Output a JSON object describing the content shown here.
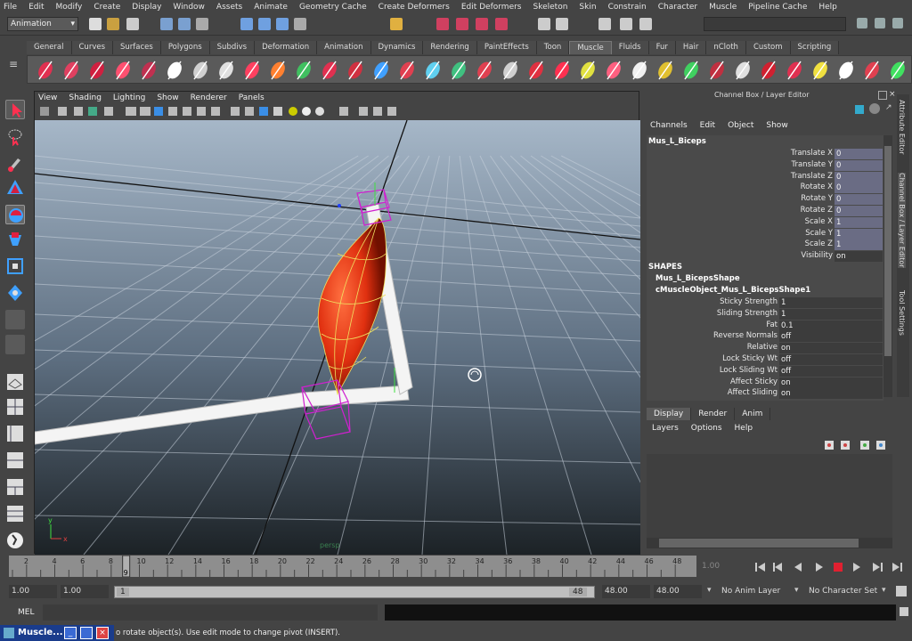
{
  "menu": [
    "File",
    "Edit",
    "Modify",
    "Create",
    "Display",
    "Window",
    "Assets",
    "Animate",
    "Geometry Cache",
    "Create Deformers",
    "Edit Deformers",
    "Skeleton",
    "Skin",
    "Constrain",
    "Character",
    "Muscle",
    "Pipeline Cache",
    "Help"
  ],
  "status": {
    "mode": "Animation"
  },
  "shelf_tabs": [
    "General",
    "Curves",
    "Surfaces",
    "Polygons",
    "Subdivs",
    "Deformation",
    "Animation",
    "Dynamics",
    "Rendering",
    "PaintEffects",
    "Toon",
    "Muscle",
    "Fluids",
    "Fur",
    "Hair",
    "nCloth",
    "Custom",
    "Scripting"
  ],
  "active_shelf": "Muscle",
  "viewport": {
    "menu": [
      "View",
      "Shading",
      "Lighting",
      "Show",
      "Renderer",
      "Panels"
    ],
    "persp_label": "persp",
    "axis_y": "y",
    "axis_x": "x"
  },
  "channel_box": {
    "title": "Channel Box / Layer Editor",
    "menu": [
      "Channels",
      "Edit",
      "Object",
      "Show"
    ],
    "object": "Mus_L_Biceps",
    "attributes": [
      {
        "label": "Translate X",
        "value": "0"
      },
      {
        "label": "Translate Y",
        "value": "0"
      },
      {
        "label": "Translate Z",
        "value": "0"
      },
      {
        "label": "Rotate X",
        "value": "0"
      },
      {
        "label": "Rotate Y",
        "value": "0"
      },
      {
        "label": "Rotate Z",
        "value": "0"
      },
      {
        "label": "Scale X",
        "value": "1"
      },
      {
        "label": "Scale Y",
        "value": "1"
      },
      {
        "label": "Scale Z",
        "value": "1"
      },
      {
        "label": "Visibility",
        "value": "on"
      }
    ],
    "shapes_header": "SHAPES",
    "shape1": "Mus_L_BicepsShape",
    "shape2": "cMuscleObject_Mus_L_BicepsShape1",
    "shape_attrs": [
      {
        "label": "Sticky Strength",
        "value": "1"
      },
      {
        "label": "Sliding Strength",
        "value": "1"
      },
      {
        "label": "Fat",
        "value": "0.1"
      },
      {
        "label": "Reverse Normals",
        "value": "off"
      },
      {
        "label": "Relative",
        "value": "on"
      },
      {
        "label": "Lock Sticky Wt",
        "value": "off"
      },
      {
        "label": "Lock Sliding Wt",
        "value": "off"
      },
      {
        "label": "Affect Sticky",
        "value": "on"
      },
      {
        "label": "Affect Sliding",
        "value": "on"
      }
    ]
  },
  "side_tabs": [
    "Attribute Editor",
    "Channel Box / Layer Editor",
    "Tool Settings"
  ],
  "layer_editor": {
    "tabs": [
      "Display",
      "Render",
      "Anim"
    ],
    "menu": [
      "Layers",
      "Options",
      "Help"
    ]
  },
  "timeline": {
    "ticks": [
      "2",
      "4",
      "6",
      "8",
      "10",
      "12",
      "14",
      "16",
      "18",
      "20",
      "22",
      "24",
      "26",
      "28",
      "30",
      "32",
      "34",
      "36",
      "38",
      "40",
      "42",
      "44",
      "46",
      "48"
    ],
    "current_frame": "9",
    "current_field": "1.00"
  },
  "range": {
    "start": "1.00",
    "start2": "1.00",
    "range_start": "1",
    "range_end": "48",
    "end": "48.00",
    "end2": "48.00",
    "anim_layer": "No Anim Layer",
    "char_set": "No Character Set"
  },
  "cmd": {
    "label": "MEL"
  },
  "help": {
    "text": "o rotate object(s). Use edit mode to change pivot (INSERT)."
  },
  "taskbar": {
    "window_label": "Muscle..."
  }
}
